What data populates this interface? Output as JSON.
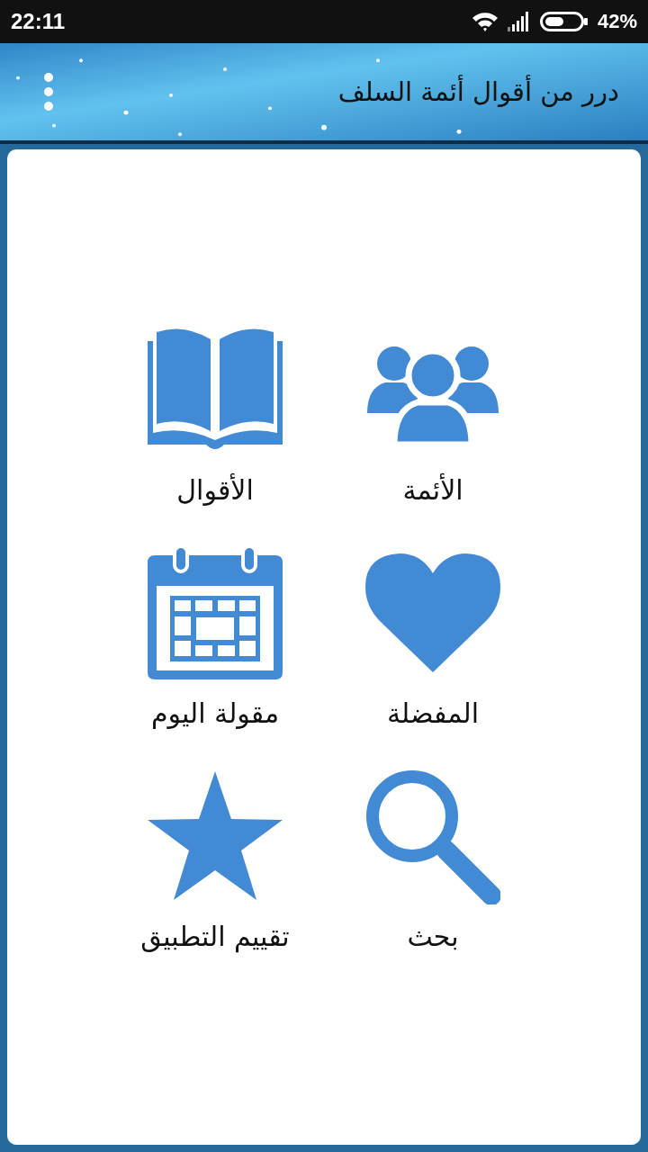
{
  "status_bar": {
    "time": "22:11",
    "battery": "42%"
  },
  "app_bar": {
    "title": "درر من أقوال أئمة السلف"
  },
  "menu_items": [
    {
      "label": "الأئمة",
      "kind": "people"
    },
    {
      "label": "الأقوال",
      "kind": "book"
    },
    {
      "label": "المفضلة",
      "kind": "heart"
    },
    {
      "label": "مقولة اليوم",
      "kind": "calendar"
    },
    {
      "label": "بحث",
      "kind": "search"
    },
    {
      "label": "تقييم التطبيق",
      "kind": "star"
    }
  ]
}
